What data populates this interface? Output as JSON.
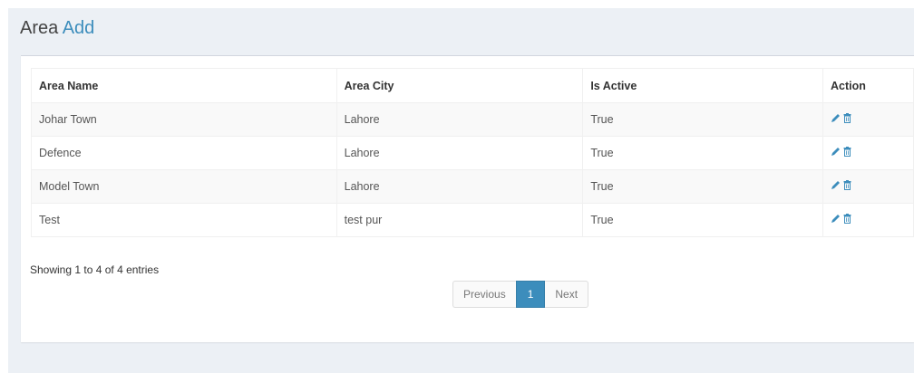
{
  "header": {
    "title": "Area",
    "add_label": "Add"
  },
  "table": {
    "columns": [
      "Area Name",
      "Area City",
      "Is Active",
      "Action"
    ],
    "rows": [
      {
        "name": "Johar Town",
        "city": "Lahore",
        "active": "True"
      },
      {
        "name": "Defence",
        "city": "Lahore",
        "active": "True"
      },
      {
        "name": "Model Town",
        "city": "Lahore",
        "active": "True"
      },
      {
        "name": "Test",
        "city": "test pur",
        "active": "True"
      }
    ]
  },
  "footer": {
    "info": "Showing 1 to 4 of 4 entries"
  },
  "pagination": {
    "previous": "Previous",
    "current": "1",
    "next": "Next"
  },
  "icons": {
    "edit": "pencil-icon",
    "delete": "trash-icon"
  },
  "colors": {
    "accent": "#3c8dbc",
    "page_background": "#ecf0f5"
  }
}
